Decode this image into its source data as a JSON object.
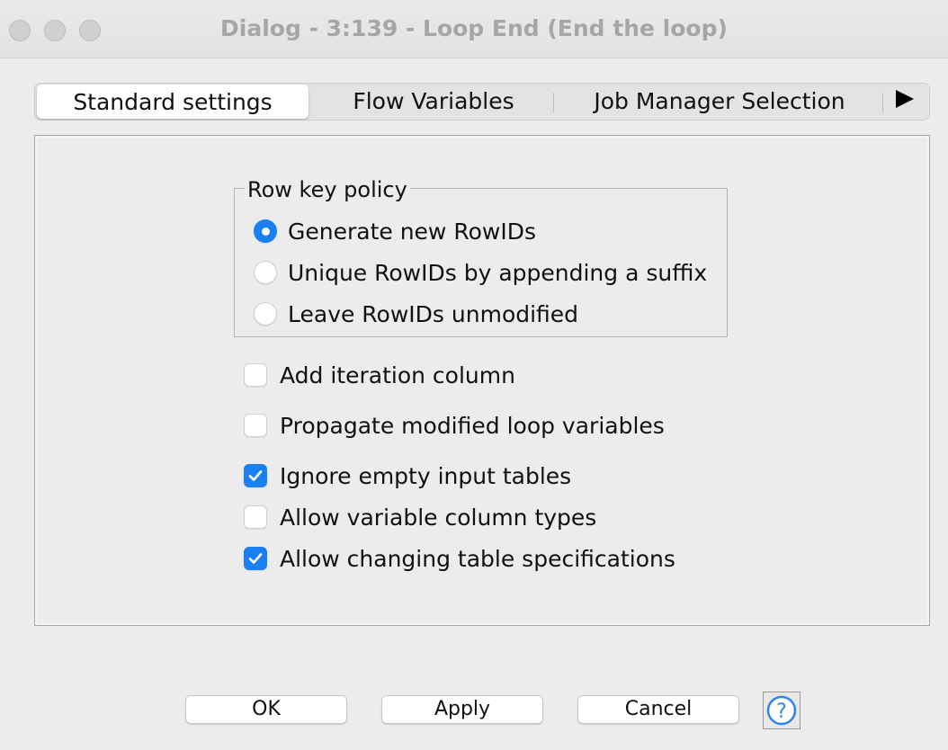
{
  "window": {
    "title": "Dialog - 3:139 - Loop End (End the loop)"
  },
  "tabs": [
    {
      "label": "Standard settings",
      "active": true
    },
    {
      "label": "Flow Variables",
      "active": false
    },
    {
      "label": "Job Manager Selection",
      "active": false
    }
  ],
  "row_key_policy": {
    "legend": "Row key policy",
    "options": [
      {
        "label": "Generate new RowIDs",
        "selected": true
      },
      {
        "label": "Unique RowIDs by appending a suffix",
        "selected": false
      },
      {
        "label": "Leave RowIDs unmodified",
        "selected": false
      }
    ]
  },
  "checkboxes": [
    {
      "label": "Add iteration column",
      "checked": false
    },
    {
      "label": "Propagate modified loop variables",
      "checked": false
    },
    {
      "label": "Ignore empty input tables",
      "checked": true
    },
    {
      "label": "Allow variable column types",
      "checked": false
    },
    {
      "label": "Allow changing table specifications",
      "checked": true
    }
  ],
  "buttons": {
    "ok": "OK",
    "apply": "Apply",
    "cancel": "Cancel",
    "help": "?"
  },
  "colors": {
    "accent": "#1a7ff0",
    "help_icon": "#2f86e8"
  }
}
